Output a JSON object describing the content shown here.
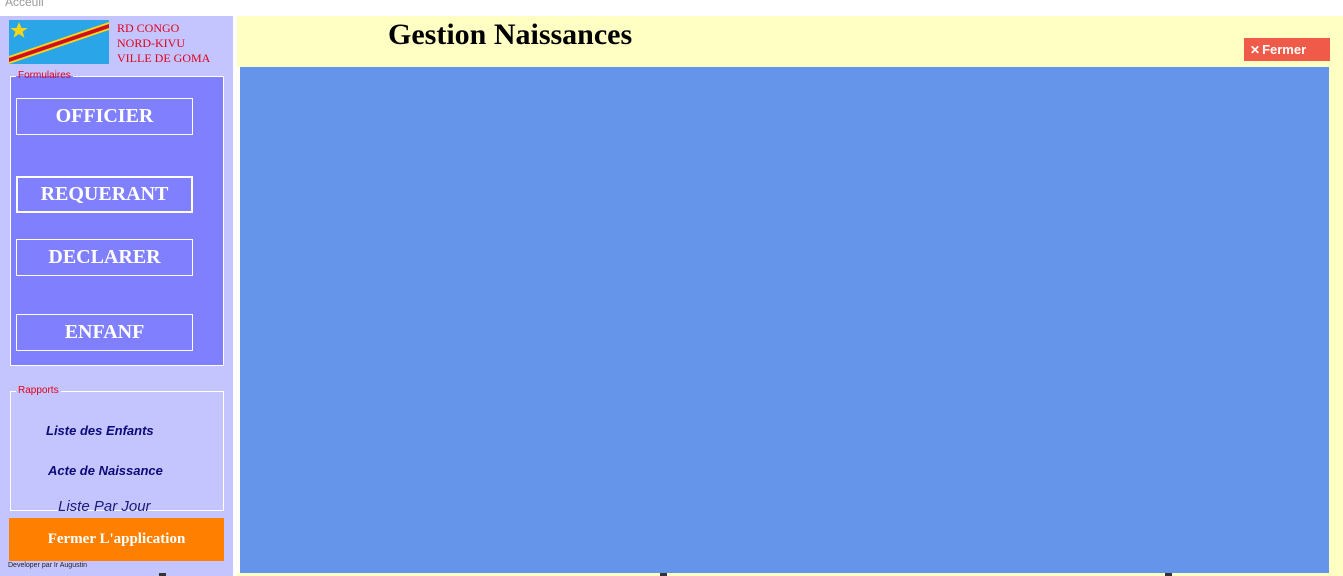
{
  "window": {
    "title": "Acceuil"
  },
  "sidebar": {
    "region_lines": [
      "RD CONGO",
      "NORD-KIVU",
      "VILLE DE GOMA"
    ],
    "forms_group": {
      "legend": "Formulaires",
      "buttons": [
        "OFFICIER",
        "REQUERANT",
        "DECLARER",
        "ENFANF"
      ]
    },
    "reports_group": {
      "legend": "Rapports",
      "links": [
        "Liste des Enfants",
        "Acte de Naissance",
        "Liste Par Jour"
      ]
    },
    "quit_label": "Fermer L'application",
    "developer_credit": "Developer par Ir Augustin"
  },
  "header": {
    "title": "Gestion Naissances",
    "close_icon": "close-icon",
    "close_label": "Fermer"
  },
  "colors": {
    "sidebar_bg": "#c4c4ff",
    "forms_bg": "#8080ff",
    "header_bg": "#ffffc4",
    "content_bg": "#6495ea",
    "quit_button": "#ff7f00",
    "close_button": "#f05a48",
    "region_text": "#e0001b"
  }
}
